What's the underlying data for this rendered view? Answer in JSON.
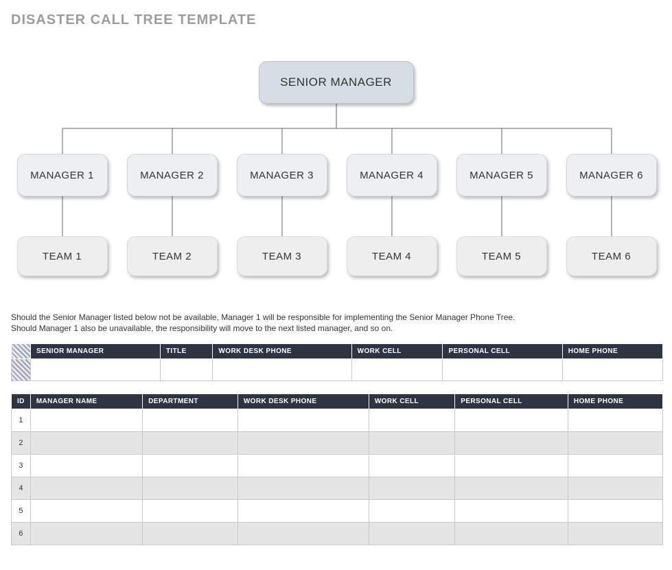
{
  "title": "DISASTER CALL TREE TEMPLATE",
  "tree": {
    "root": "SENIOR MANAGER",
    "managers": [
      "MANAGER 1",
      "MANAGER 2",
      "MANAGER 3",
      "MANAGER 4",
      "MANAGER 5",
      "MANAGER 6"
    ],
    "teams": [
      "TEAM 1",
      "TEAM 2",
      "TEAM 3",
      "TEAM 4",
      "TEAM 5",
      "TEAM 6"
    ]
  },
  "explain": {
    "line1": "Should the Senior Manager listed below not be available, Manager 1 will be responsible for implementing the Senior Manager Phone Tree.",
    "line2": "Should Manager 1 also be unavailable, the responsibility will move to the next listed manager, and so on."
  },
  "sm_table": {
    "headers": [
      "SENIOR MANAGER",
      "TITLE",
      "WORK DESK PHONE",
      "WORK CELL",
      "PERSONAL CELL",
      "HOME PHONE"
    ],
    "row": [
      "",
      "",
      "",
      "",
      "",
      ""
    ]
  },
  "mgr_table": {
    "headers": [
      "ID",
      "MANAGER NAME",
      "DEPARTMENT",
      "WORK DESK PHONE",
      "WORK CELL",
      "PERSONAL CELL",
      "HOME PHONE"
    ],
    "rows": [
      {
        "id": "1",
        "cells": [
          "",
          "",
          "",
          "",
          "",
          ""
        ]
      },
      {
        "id": "2",
        "cells": [
          "",
          "",
          "",
          "",
          "",
          ""
        ]
      },
      {
        "id": "3",
        "cells": [
          "",
          "",
          "",
          "",
          "",
          ""
        ]
      },
      {
        "id": "4",
        "cells": [
          "",
          "",
          "",
          "",
          "",
          ""
        ]
      },
      {
        "id": "5",
        "cells": [
          "",
          "",
          "",
          "",
          "",
          ""
        ]
      },
      {
        "id": "6",
        "cells": [
          "",
          "",
          "",
          "",
          "",
          ""
        ]
      }
    ]
  }
}
